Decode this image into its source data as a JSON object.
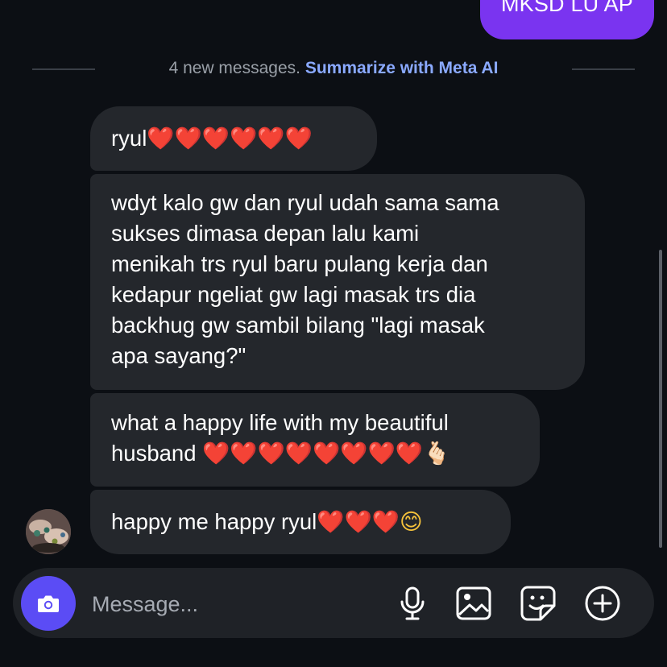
{
  "outgoing": {
    "last_message": "MKSD LU AP"
  },
  "divider": {
    "new_messages": "4 new messages.",
    "summarize_link": "Summarize with Meta AI"
  },
  "messages": [
    {
      "text": "ryul",
      "emoji": "❤️❤️❤️❤️❤️❤️"
    },
    {
      "lines": [
        "wdyt kalo gw dan ryul udah sama sama",
        "sukses dimasa depan lalu kami",
        "menikah trs ryul baru pulang kerja dan",
        "kedapur ngeliat gw lagi masak trs dia",
        "backhug gw sambil bilang \"lagi masak",
        "apa sayang?\""
      ]
    },
    {
      "line1": "what a happy life with my beautiful",
      "line2": "husband ",
      "emoji": "❤️❤️❤️❤️❤️❤️❤️❤️",
      "emoji2": "🫰🏻"
    },
    {
      "text": "happy me happy ryul ",
      "emoji": "❤️❤️❤️",
      "emoji2": "😊"
    }
  ],
  "composer": {
    "placeholder": "Message...",
    "icons": [
      "camera-icon",
      "microphone-icon",
      "gallery-icon",
      "sticker-icon",
      "plus-icon"
    ]
  },
  "colors": {
    "background": "#0c0f14",
    "outgoing_bubble": "#7a34f0",
    "incoming_bubble": "#24272c",
    "link": "#8aa9ff",
    "camera_button": "#5b4cf5"
  }
}
